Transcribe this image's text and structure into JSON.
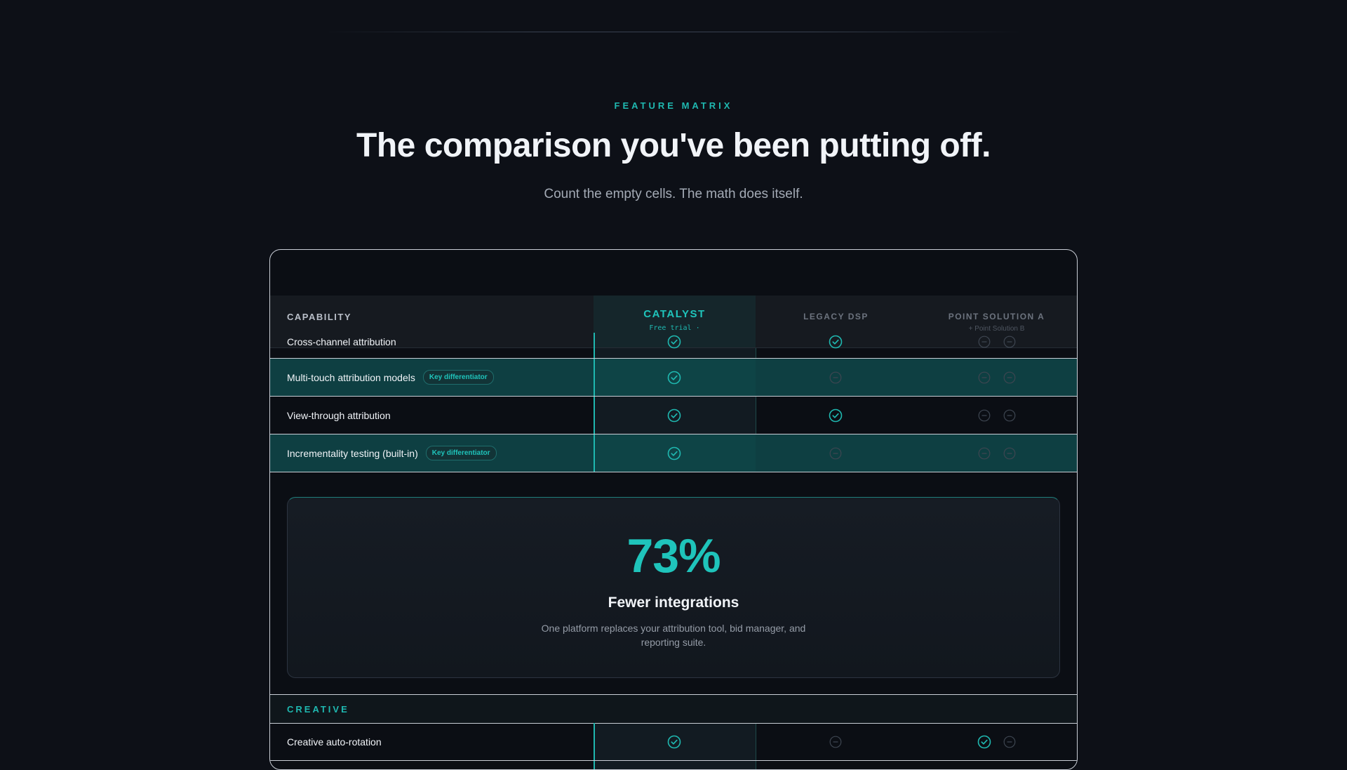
{
  "hero": {
    "eyebrow": "FEATURE MATRIX",
    "title": "The comparison you've been putting off.",
    "subtitle": "Count the empty cells. The math does itself."
  },
  "table": {
    "header": {
      "capability": "CAPABILITY",
      "catalyst": {
        "name": "CATALYST",
        "sub": "Free trial ·"
      },
      "legacy": {
        "name": "LEGACY DSP"
      },
      "point": {
        "name": "POINT SOLUTION A",
        "sub": "+ Point Solution B"
      }
    },
    "rows": [
      {
        "label": "Cross-channel attribution",
        "badge": "",
        "catalyst": "check",
        "legacy": "check",
        "point_a": "dash",
        "point_b": "dash"
      },
      {
        "label": "Multi-touch attribution models",
        "badge": "Key differentiator",
        "catalyst": "check",
        "legacy": "dash",
        "point_a": "dash",
        "point_b": "dash"
      },
      {
        "label": "View-through attribution",
        "badge": "",
        "catalyst": "check",
        "legacy": "check",
        "point_a": "dash",
        "point_b": "dash"
      },
      {
        "label": "Incrementality testing (built-in)",
        "badge": "Key differentiator",
        "catalyst": "check",
        "legacy": "dash",
        "point_a": "dash",
        "point_b": "dash"
      }
    ],
    "stat": {
      "value": "73%",
      "title": "Fewer integrations",
      "description": "One platform replaces your attribution tool, bid manager, and reporting suite."
    },
    "section": "CREATIVE",
    "section_rows": [
      {
        "label": "Creative auto-rotation",
        "catalyst": "check",
        "legacy": "dash",
        "point_a": "check",
        "point_b": "dash"
      }
    ]
  },
  "colors": {
    "accent": "#1fc4bb",
    "background": "#0d1017",
    "highlight_row": "#0e3f42"
  },
  "icons": {
    "check": "check-circle-icon",
    "dash": "dash-circle-icon"
  }
}
